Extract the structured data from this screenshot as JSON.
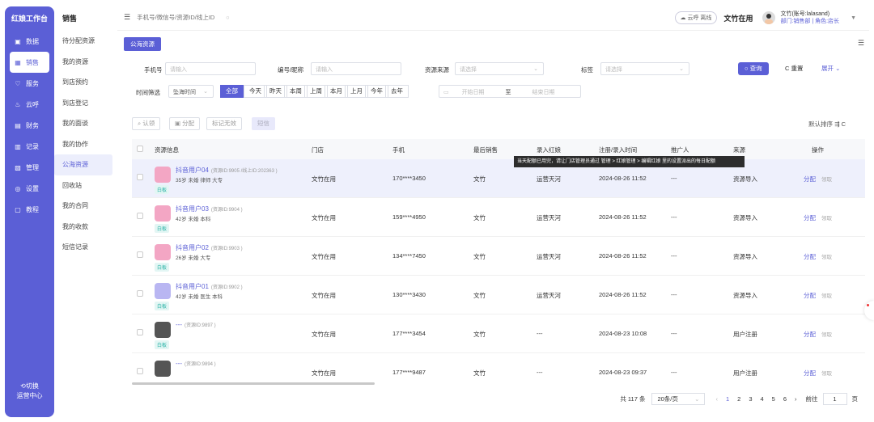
{
  "rail": {
    "brand": "红娘工作台",
    "items": [
      {
        "label": "数据",
        "icon": "data-icon"
      },
      {
        "label": "销售",
        "icon": "sales-icon",
        "active": true
      },
      {
        "label": "服务",
        "icon": "heart-icon"
      },
      {
        "label": "云呼",
        "icon": "cloud-call-icon"
      },
      {
        "label": "财务",
        "icon": "finance-icon"
      },
      {
        "label": "记录",
        "icon": "record-icon"
      },
      {
        "label": "管理",
        "icon": "manage-icon"
      },
      {
        "label": "设置",
        "icon": "settings-icon"
      },
      {
        "label": "教程",
        "icon": "tutorial-icon"
      }
    ],
    "footer_line1": "切换",
    "footer_line2": "运营中心"
  },
  "submenu": {
    "title": "销售",
    "items": [
      "待分配资源",
      "我的资源",
      "到店预约",
      "到店登记",
      "我的面谈",
      "我的协作",
      "公海资源",
      "回收站",
      "我的合同",
      "我的收款",
      "短信记录"
    ],
    "active_index": 6
  },
  "topbar": {
    "search_placeholder": "手机号/微信号/资源ID/线上ID",
    "cloud_status": "云呼 离线",
    "store_name": "文竹在用",
    "user_name": "文竹(账号:lalasand)",
    "user_dept": "部门:销售部 | 角色:店长"
  },
  "tab": {
    "label": "公海资源"
  },
  "filters": {
    "phone_label": "手机号",
    "phone_placeholder": "请输入",
    "code_label": "编号/昵称",
    "code_placeholder": "请输入",
    "source_label": "资源来源",
    "source_placeholder": "请选择",
    "tag_label": "标签",
    "tag_placeholder": "请选择",
    "query_btn": "查询",
    "reset_btn": "重置",
    "expand_btn": "展开",
    "time_label": "时间筛选",
    "time_select": "坠海时间",
    "date_buttons": [
      "全部",
      "今天",
      "昨天",
      "本周",
      "上周",
      "本月",
      "上月",
      "今年",
      "去年"
    ],
    "start_placeholder": "开始日期",
    "range_sep": "至",
    "end_placeholder": "结束日期"
  },
  "actions": {
    "claim": "认领",
    "assign": "分配",
    "mark_invalid": "标记无效",
    "sms": "短信",
    "sort": "默认排序"
  },
  "table": {
    "headers": [
      "资源信息",
      "门店",
      "手机",
      "最后销售",
      "录入红娘",
      "注册/录入时间",
      "推广人",
      "来源",
      "操作"
    ],
    "rows": [
      {
        "name": "抖音用户04",
        "rid": "(资源ID:9905 /线上ID:202363 )",
        "meta": "35岁 未婚 律师 大专",
        "tag": "白板",
        "store": "文竹在用",
        "phone": "170****3450",
        "last_sales": "文竹",
        "entry": "运营天河",
        "time": "2024-08-26 11:52",
        "promoter": "---",
        "source": "资源导入",
        "op1": "分配",
        "op2": "领取"
      },
      {
        "name": "抖音用户03",
        "rid": "(资源ID:9904 )",
        "meta": "42岁 未婚 本科",
        "tag": "白板",
        "store": "文竹在用",
        "phone": "159****4950",
        "last_sales": "文竹",
        "entry": "运营天河",
        "time": "2024-08-26 11:52",
        "promoter": "---",
        "source": "资源导入",
        "op1": "分配",
        "op2": "领取"
      },
      {
        "name": "抖音用户02",
        "rid": "(资源ID:9903 )",
        "meta": "26岁 未婚 大专",
        "tag": "白板",
        "store": "文竹在用",
        "phone": "134****7450",
        "last_sales": "文竹",
        "entry": "运营天河",
        "time": "2024-08-26 11:52",
        "promoter": "---",
        "source": "资源导入",
        "op1": "分配",
        "op2": "领取"
      },
      {
        "name": "抖音用户01",
        "rid": "(资源ID:9902 )",
        "meta": "42岁 未婚 医生 本科",
        "tag": "白板",
        "store": "文竹在用",
        "phone": "130****3430",
        "last_sales": "文竹",
        "entry": "运营天河",
        "time": "2024-08-26 11:52",
        "promoter": "---",
        "source": "资源导入",
        "op1": "分配",
        "op2": "领取"
      },
      {
        "name": "---",
        "rid": "(资源ID:9897 )",
        "meta": "",
        "tag": "白板",
        "store": "文竹在用",
        "phone": "177****3454",
        "last_sales": "文竹",
        "entry": "---",
        "time": "2024-08-23 10:08",
        "promoter": "---",
        "source": "用户注册",
        "op1": "分配",
        "op2": "领取"
      },
      {
        "name": "---",
        "rid": "(资源ID:9894 )",
        "meta": "",
        "tag": "",
        "store": "文竹在用",
        "phone": "177****9487",
        "last_sales": "文竹",
        "entry": "---",
        "time": "2024-08-23 09:37",
        "promoter": "---",
        "source": "用户注册",
        "op1": "分配",
        "op2": "领取"
      }
    ]
  },
  "tooltip": "当天配额已用完，请让门店管理员通过 管理 > 红娘管理 > 编辑红娘 里的设置派出的每日配额",
  "pager": {
    "total": "共 117 条",
    "page_size": "20条/页",
    "pages": [
      "1",
      "2",
      "3",
      "4",
      "5",
      "6"
    ],
    "current": "1",
    "goto_label": "前往",
    "goto_value": "1",
    "page_unit": "页"
  },
  "colors": {
    "accent": "#5b5fd6",
    "tag": "#2bb3a7"
  }
}
